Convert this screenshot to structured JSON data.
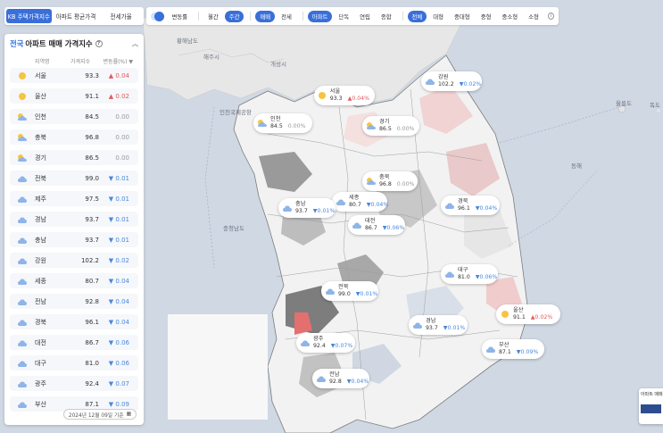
{
  "top_tabs": [
    {
      "label": "KB 주택가격지수",
      "active": true
    },
    {
      "label": "아파트 평균가격",
      "active": false
    },
    {
      "label": "전세가율",
      "active": false
    }
  ],
  "filters": {
    "toggle_label": "변동률",
    "period": [
      {
        "label": "월간",
        "on": false
      },
      {
        "label": "주간",
        "on": true
      }
    ],
    "deal": [
      {
        "label": "매매",
        "on": true
      },
      {
        "label": "전세",
        "on": false
      }
    ],
    "housing": [
      {
        "label": "아파트",
        "on": true
      },
      {
        "label": "단독",
        "on": false
      },
      {
        "label": "연립",
        "on": false
      },
      {
        "label": "종합",
        "on": false
      }
    ],
    "size": [
      {
        "label": "전체",
        "on": true
      },
      {
        "label": "대형",
        "on": false
      },
      {
        "label": "중대형",
        "on": false
      },
      {
        "label": "중형",
        "on": false
      },
      {
        "label": "중소형",
        "on": false
      },
      {
        "label": "소형",
        "on": false
      }
    ]
  },
  "panel": {
    "title_prefix": "전국",
    "title": "아파트 매매 가격지수",
    "columns": {
      "region": "지역명",
      "price": "가격지수",
      "change": "변동률(%) ▼"
    },
    "date": "2024년 12월 09일 기준",
    "rows": [
      {
        "name": "서울",
        "price": "93.3",
        "change": "▲ 0.04",
        "dir": "up",
        "icon": "sun-icon"
      },
      {
        "name": "울산",
        "price": "91.1",
        "change": "▲ 0.02",
        "dir": "up",
        "icon": "sun-icon"
      },
      {
        "name": "인천",
        "price": "84.5",
        "change": "0.00",
        "dir": "flat",
        "icon": "partly-cloudy-icon"
      },
      {
        "name": "충북",
        "price": "96.8",
        "change": "0.00",
        "dir": "flat",
        "icon": "partly-cloudy-icon"
      },
      {
        "name": "경기",
        "price": "86.5",
        "change": "0.00",
        "dir": "flat",
        "icon": "partly-cloudy-icon"
      },
      {
        "name": "전북",
        "price": "99.0",
        "change": "▼ 0.01",
        "dir": "down",
        "icon": "cloud-icon"
      },
      {
        "name": "제주",
        "price": "97.5",
        "change": "▼ 0.01",
        "dir": "down",
        "icon": "cloud-icon"
      },
      {
        "name": "경남",
        "price": "93.7",
        "change": "▼ 0.01",
        "dir": "down",
        "icon": "cloud-icon"
      },
      {
        "name": "충남",
        "price": "93.7",
        "change": "▼ 0.01",
        "dir": "down",
        "icon": "cloud-icon"
      },
      {
        "name": "강원",
        "price": "102.2",
        "change": "▼ 0.02",
        "dir": "down",
        "icon": "cloud-icon"
      },
      {
        "name": "세종",
        "price": "80.7",
        "change": "▼ 0.04",
        "dir": "down",
        "icon": "cloud-icon"
      },
      {
        "name": "전남",
        "price": "92.8",
        "change": "▼ 0.04",
        "dir": "down",
        "icon": "cloud-icon"
      },
      {
        "name": "경북",
        "price": "96.1",
        "change": "▼ 0.04",
        "dir": "down",
        "icon": "cloud-icon"
      },
      {
        "name": "대전",
        "price": "86.7",
        "change": "▼ 0.06",
        "dir": "down",
        "icon": "cloud-icon"
      },
      {
        "name": "대구",
        "price": "81.0",
        "change": "▼ 0.06",
        "dir": "down",
        "icon": "cloud-icon"
      },
      {
        "name": "광주",
        "price": "92.4",
        "change": "▼ 0.07",
        "dir": "down",
        "icon": "cloud-icon"
      },
      {
        "name": "부산",
        "price": "87.1",
        "change": "▼ 0.09",
        "dir": "down",
        "icon": "cloud-icon"
      }
    ]
  },
  "map_labels": [
    "황해남도",
    "개성시",
    "해주시",
    "인천국제공항",
    "동해",
    "울릉도",
    "독도",
    "충청남도"
  ],
  "bubbles": [
    {
      "name": "강원",
      "price": "102.2",
      "change": "▼0.02%",
      "dir": "down",
      "icon": "cloud-icon"
    },
    {
      "name": "서울",
      "price": "93.3",
      "change": "▲0.04%",
      "dir": "up",
      "icon": "sun-icon"
    },
    {
      "name": "인천",
      "price": "84.5",
      "change": "0.00%",
      "dir": "flat",
      "icon": "partly-cloudy-icon"
    },
    {
      "name": "경기",
      "price": "86.5",
      "change": "0.00%",
      "dir": "flat",
      "icon": "partly-cloudy-icon"
    },
    {
      "name": "충북",
      "price": "96.8",
      "change": "0.00%",
      "dir": "flat",
      "icon": "partly-cloudy-icon"
    },
    {
      "name": "세종",
      "price": "80.7",
      "change": "▼0.04%",
      "dir": "down",
      "icon": "cloud-icon"
    },
    {
      "name": "충남",
      "price": "93.7",
      "change": "▼0.01%",
      "dir": "down",
      "icon": "cloud-icon"
    },
    {
      "name": "대전",
      "price": "86.7",
      "change": "▼0.06%",
      "dir": "down",
      "icon": "cloud-icon"
    },
    {
      "name": "경북",
      "price": "96.1",
      "change": "▼0.04%",
      "dir": "down",
      "icon": "cloud-icon"
    },
    {
      "name": "대구",
      "price": "81.0",
      "change": "▼0.06%",
      "dir": "down",
      "icon": "cloud-icon"
    },
    {
      "name": "전북",
      "price": "99.0",
      "change": "▼0.01%",
      "dir": "down",
      "icon": "cloud-icon"
    },
    {
      "name": "울산",
      "price": "91.1",
      "change": "▲0.02%",
      "dir": "up",
      "icon": "sun-icon"
    },
    {
      "name": "경남",
      "price": "93.7",
      "change": "▼0.01%",
      "dir": "down",
      "icon": "cloud-icon"
    },
    {
      "name": "광주",
      "price": "92.4",
      "change": "▼0.07%",
      "dir": "down",
      "icon": "cloud-icon"
    },
    {
      "name": "부산",
      "price": "87.1",
      "change": "▼0.09%",
      "dir": "down",
      "icon": "cloud-icon"
    },
    {
      "name": "전남",
      "price": "92.8",
      "change": "▼0.04%",
      "dir": "down",
      "icon": "cloud-icon"
    }
  ],
  "widget_label": "아파트 매매",
  "colors": {
    "accent": "#3a6fd9",
    "up": "#e15b5b",
    "down": "#4a89dc",
    "sea": "#cfd8e3",
    "land_north": "#e6e6e6"
  }
}
